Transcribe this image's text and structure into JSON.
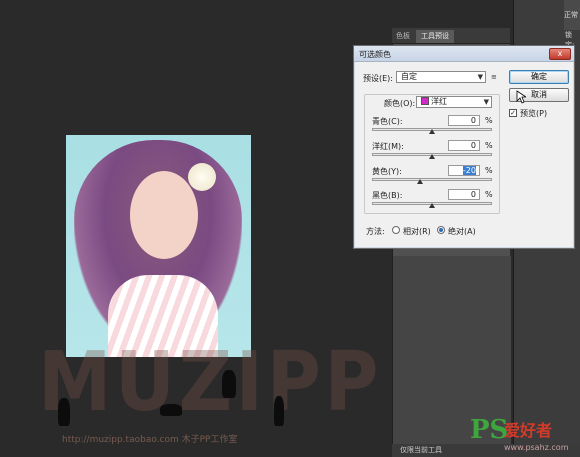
{
  "workspace": {
    "right_strip_labels": [
      "正常",
      "锁定:"
    ],
    "panel_tabs": [
      "色板",
      "工具预设"
    ],
    "bottom_strip_label": "仅限当前工具"
  },
  "watermark": {
    "big_text": "MUZIPP",
    "url_text": "http://muzipp.taobao.com 木子PP工作室"
  },
  "logo": {
    "ps": "PS",
    "cn": "爱好者",
    "url": "www.psahz.com"
  },
  "dialog": {
    "title": "可选颜色",
    "close_label": "x",
    "preset_label": "预设(E):",
    "preset_value": "自定",
    "preset_menu": "≡",
    "ok_label": "确定",
    "cancel_label": "取消",
    "preview_label": "预览(P)",
    "preview_checked": true,
    "color_label": "颜色(O):",
    "color_value": "洋红",
    "color_swatch": "#d528c8",
    "sliders": [
      {
        "label": "青色(C):",
        "value": "0",
        "unit": "%",
        "level": 0
      },
      {
        "label": "洋红(M):",
        "value": "0",
        "unit": "%",
        "level": 0
      },
      {
        "label": "黄色(Y):",
        "value": "-20",
        "unit": "%",
        "level": -20
      },
      {
        "label": "黑色(B):",
        "value": "0",
        "unit": "%",
        "level": 0
      }
    ],
    "method_label": "方法:",
    "method_options": [
      "相对(R)",
      "绝对(A)"
    ],
    "method_selected": "绝对(A)"
  }
}
